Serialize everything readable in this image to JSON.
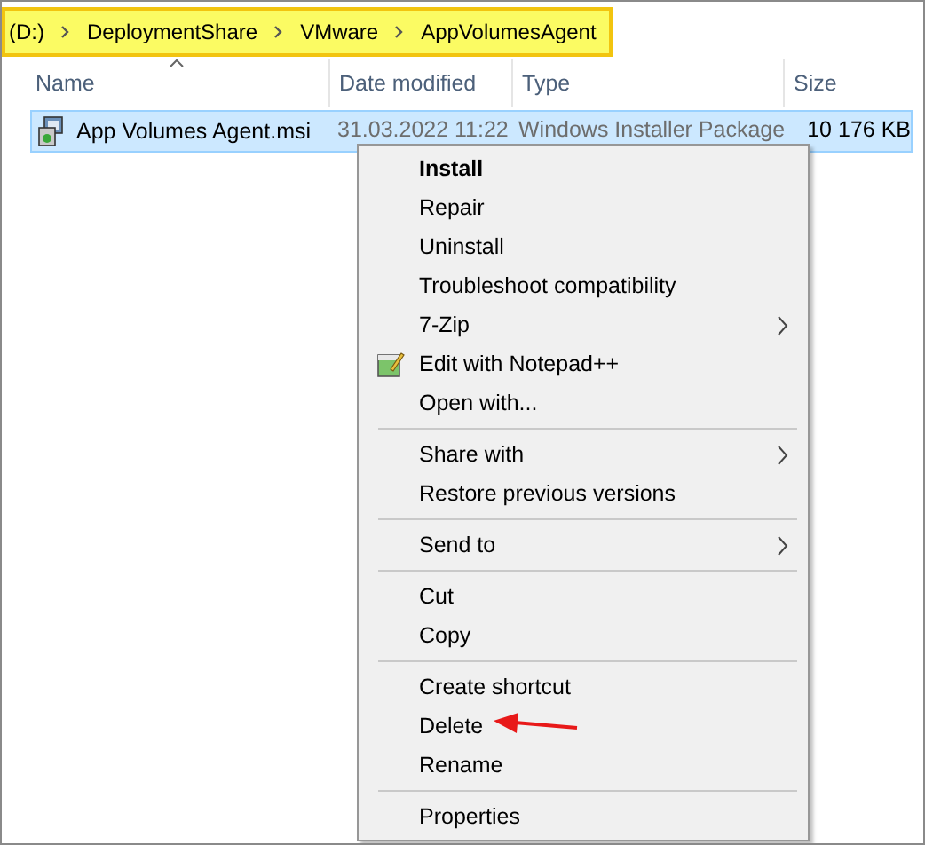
{
  "breadcrumb": {
    "highlighted": true,
    "parts": [
      "(D:)",
      "DeploymentShare",
      "VMware",
      "AppVolumesAgent"
    ]
  },
  "columns": [
    {
      "label": "Name",
      "sorted": true
    },
    {
      "label": "Date modified",
      "sorted": false
    },
    {
      "label": "Type",
      "sorted": false
    },
    {
      "label": "Size",
      "sorted": false
    }
  ],
  "files": [
    {
      "name": "App Volumes Agent.msi",
      "date": "31.03.2022 11:22",
      "type": "Windows Installer Package",
      "size": "10 176 KB",
      "selected": true
    }
  ],
  "context_menu": {
    "items": [
      {
        "kind": "item",
        "label": "Install",
        "default": true,
        "submenu": false,
        "icon": false,
        "pointed": false
      },
      {
        "kind": "item",
        "label": "Repair",
        "default": false,
        "submenu": false,
        "icon": false,
        "pointed": false
      },
      {
        "kind": "item",
        "label": "Uninstall",
        "default": false,
        "submenu": false,
        "icon": false,
        "pointed": false
      },
      {
        "kind": "item",
        "label": "Troubleshoot compatibility",
        "default": false,
        "submenu": false,
        "icon": false,
        "pointed": false
      },
      {
        "kind": "item",
        "label": "7-Zip",
        "default": false,
        "submenu": true,
        "icon": false,
        "pointed": false
      },
      {
        "kind": "item",
        "label": "Edit with Notepad++",
        "default": false,
        "submenu": false,
        "icon": true,
        "pointed": false
      },
      {
        "kind": "item",
        "label": "Open with...",
        "default": false,
        "submenu": false,
        "icon": false,
        "pointed": false
      },
      {
        "kind": "separator"
      },
      {
        "kind": "item",
        "label": "Share with",
        "default": false,
        "submenu": true,
        "icon": false,
        "pointed": false
      },
      {
        "kind": "item",
        "label": "Restore previous versions",
        "default": false,
        "submenu": false,
        "icon": false,
        "pointed": false
      },
      {
        "kind": "separator"
      },
      {
        "kind": "item",
        "label": "Send to",
        "default": false,
        "submenu": true,
        "icon": false,
        "pointed": false
      },
      {
        "kind": "separator"
      },
      {
        "kind": "item",
        "label": "Cut",
        "default": false,
        "submenu": false,
        "icon": false,
        "pointed": false
      },
      {
        "kind": "item",
        "label": "Copy",
        "default": false,
        "submenu": false,
        "icon": false,
        "pointed": false
      },
      {
        "kind": "separator"
      },
      {
        "kind": "item",
        "label": "Create shortcut",
        "default": false,
        "submenu": false,
        "icon": false,
        "pointed": false
      },
      {
        "kind": "item",
        "label": "Delete",
        "default": false,
        "submenu": false,
        "icon": false,
        "pointed": true
      },
      {
        "kind": "item",
        "label": "Rename",
        "default": false,
        "submenu": false,
        "icon": false,
        "pointed": false
      },
      {
        "kind": "separator"
      },
      {
        "kind": "item",
        "label": "Properties",
        "default": false,
        "submenu": false,
        "icon": false,
        "pointed": false
      }
    ]
  }
}
